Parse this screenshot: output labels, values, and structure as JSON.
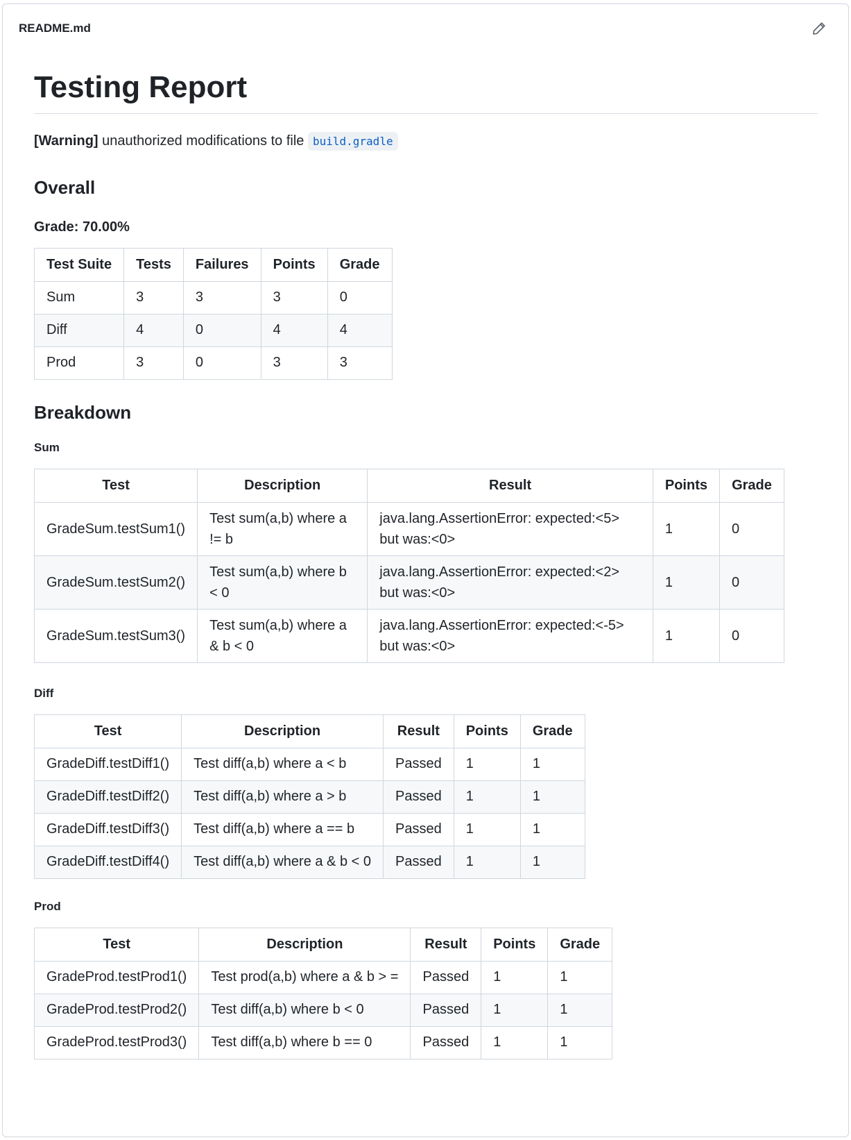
{
  "file": {
    "name": "README.md"
  },
  "heading": "Testing Report",
  "warning": {
    "tag": "[Warning]",
    "text": " unauthorized modifications to file ",
    "file": "build.gradle"
  },
  "overall": {
    "title": "Overall",
    "grade": "Grade: 70.00%",
    "headers": [
      "Test Suite",
      "Tests",
      "Failures",
      "Points",
      "Grade"
    ],
    "rows": [
      [
        "Sum",
        "3",
        "3",
        "3",
        "0"
      ],
      [
        "Diff",
        "4",
        "0",
        "4",
        "4"
      ],
      [
        "Prod",
        "3",
        "0",
        "3",
        "3"
      ]
    ]
  },
  "breakdown": {
    "title": "Breakdown",
    "headers": [
      "Test",
      "Description",
      "Result",
      "Points",
      "Grade"
    ],
    "sum": {
      "title": "Sum",
      "rows": [
        [
          "GradeSum.testSum1()",
          "Test sum(a,b) where a != b",
          "java.lang.AssertionError: expected:<5> but was:<0>",
          "1",
          "0"
        ],
        [
          "GradeSum.testSum2()",
          "Test sum(a,b) where b < 0",
          "java.lang.AssertionError: expected:<2> but was:<0>",
          "1",
          "0"
        ],
        [
          "GradeSum.testSum3()",
          "Test sum(a,b) where a & b < 0",
          "java.lang.AssertionError: expected:<-5> but was:<0>",
          "1",
          "0"
        ]
      ]
    },
    "diff": {
      "title": "Diff",
      "rows": [
        [
          "GradeDiff.testDiff1()",
          "Test diff(a,b) where a < b",
          "Passed",
          "1",
          "1"
        ],
        [
          "GradeDiff.testDiff2()",
          "Test diff(a,b) where a > b",
          "Passed",
          "1",
          "1"
        ],
        [
          "GradeDiff.testDiff3()",
          "Test diff(a,b) where a == b",
          "Passed",
          "1",
          "1"
        ],
        [
          "GradeDiff.testDiff4()",
          "Test diff(a,b) where a & b < 0",
          "Passed",
          "1",
          "1"
        ]
      ]
    },
    "prod": {
      "title": "Prod",
      "rows": [
        [
          "GradeProd.testProd1()",
          "Test prod(a,b) where a & b > =",
          "Passed",
          "1",
          "1"
        ],
        [
          "GradeProd.testProd2()",
          "Test diff(a,b) where b < 0",
          "Passed",
          "1",
          "1"
        ],
        [
          "GradeProd.testProd3()",
          "Test diff(a,b) where b == 0",
          "Passed",
          "1",
          "1"
        ]
      ]
    }
  }
}
